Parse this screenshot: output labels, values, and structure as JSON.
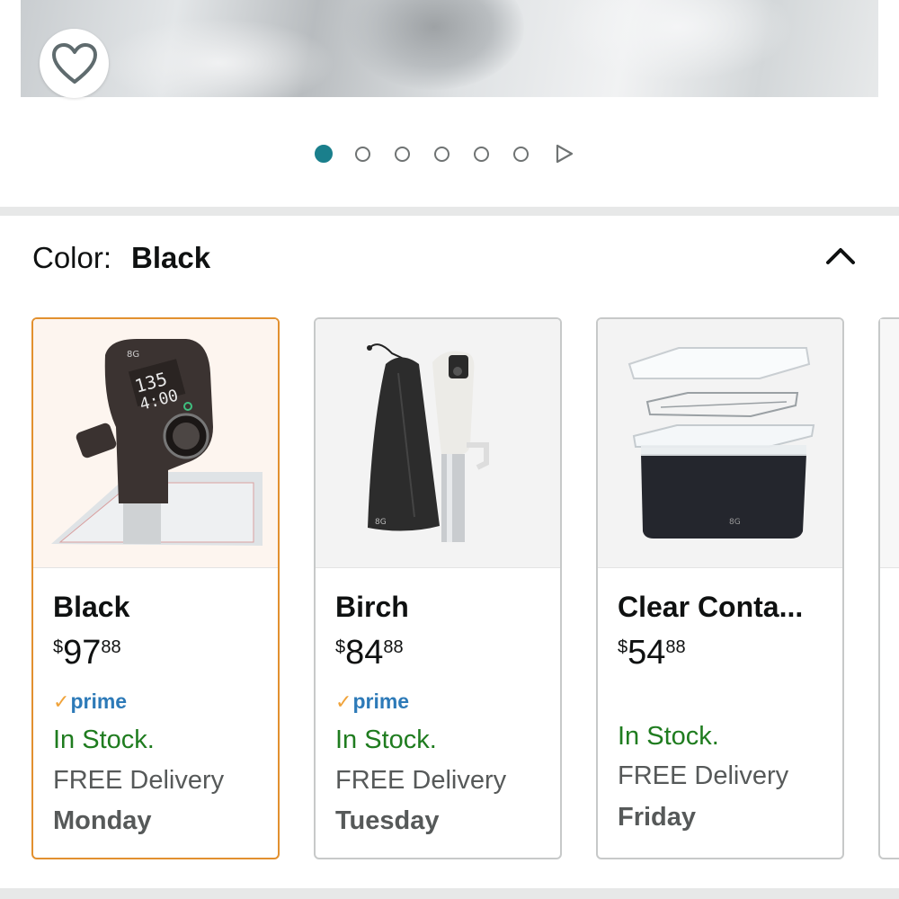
{
  "hero": {
    "favorite_icon": "heart-outline-icon"
  },
  "carousel": {
    "dot_count": 6,
    "active_index": 0,
    "accent": "#1a7f8c",
    "next_icon": "play-triangle-icon"
  },
  "variation": {
    "label": "Color:",
    "selected": "Black",
    "toggle_icon": "chevron-up-icon"
  },
  "options": [
    {
      "name": "Black",
      "price_symbol": "$",
      "price_whole": "97",
      "price_fraction": "88",
      "prime": "prime",
      "stock": "In Stock.",
      "delivery": "FREE Delivery",
      "day": "Monday",
      "selected": true
    },
    {
      "name": "Birch",
      "price_symbol": "$",
      "price_whole": "84",
      "price_fraction": "88",
      "prime": "prime",
      "stock": "In Stock.",
      "delivery": "FREE Delivery",
      "day": "Tuesday",
      "selected": false
    },
    {
      "name": "Clear Conta...",
      "price_symbol": "$",
      "price_whole": "54",
      "price_fraction": "88",
      "prime": "",
      "stock": "In Stock.",
      "delivery": "FREE Delivery",
      "day": "Friday",
      "selected": false
    }
  ],
  "colors": {
    "selected_border": "#e2902f",
    "in_stock": "#1f7c1f",
    "prime_blue": "#2d7ab8",
    "prime_check": "#f0a33a"
  }
}
